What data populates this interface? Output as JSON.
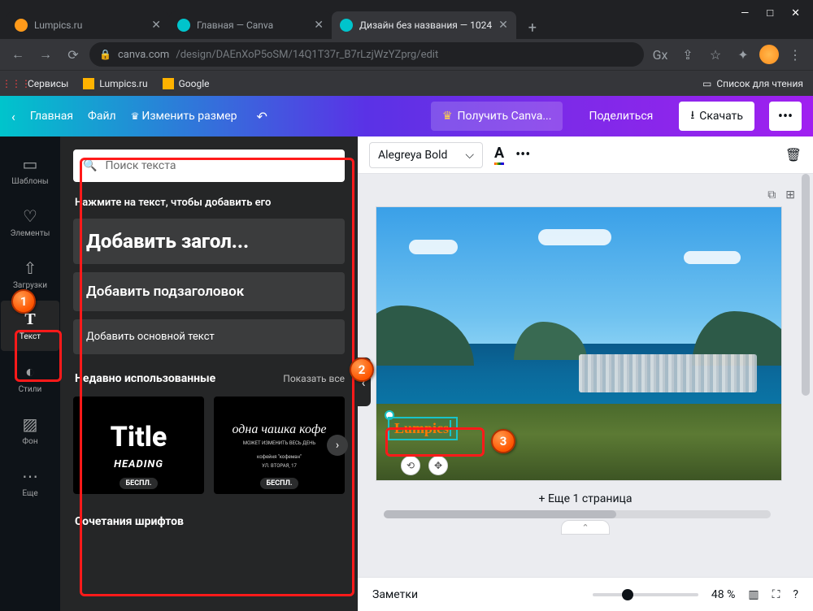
{
  "window": {
    "min": "—",
    "max": "□",
    "close": "✕"
  },
  "tabs": [
    {
      "title": "Lumpics.ru",
      "favicon": "#ff9a1a"
    },
    {
      "title": "Главная — Canva",
      "favicon": "#00c4cc"
    },
    {
      "title": "Дизайн без названия — 1024",
      "favicon": "#00c4cc",
      "active": true
    }
  ],
  "newtab": "+",
  "nav": {
    "back": "←",
    "fwd": "→",
    "reload": "⟳"
  },
  "url": {
    "lock": "🔒",
    "domain": "canva.com",
    "path": "/design/DAEnXoP5oSM/14Q1T37r_B7rLzjWzYZprg/edit"
  },
  "ricons": {
    "gx": "Gx",
    "share": "⇪",
    "star": "☆",
    "puzzle": "✦",
    "menu": "⋮"
  },
  "bookmarks": {
    "apps": "Сервисы",
    "lumpics": "Lumpics.ru",
    "google": "Google",
    "readlist": "Список для чтения"
  },
  "canva": {
    "home": "Главная",
    "file": "Файл",
    "resize": "Изменить размер",
    "getpro": "Получить Canva...",
    "share": "Поделиться",
    "download": "Скачать"
  },
  "sidebar": {
    "items": [
      {
        "icon": "▭",
        "label": "Шаблоны"
      },
      {
        "icon": "♡",
        "label": "Элементы"
      },
      {
        "icon": "⇧",
        "label": "Загрузки"
      },
      {
        "icon": "T",
        "label": "Текст"
      },
      {
        "icon": "◐",
        "label": "Стили"
      },
      {
        "icon": "▨",
        "label": "Фон"
      },
      {
        "icon": "⋯",
        "label": "Еще"
      }
    ]
  },
  "panel": {
    "search_ph": "Поиск текста",
    "hint": "Нажмите на текст, чтобы добавить его",
    "h1": "Добавить загол...",
    "h2": "Добавить подзаголовок",
    "body": "Добавить основной текст",
    "recent": "Недавно использованные",
    "showall": "Показать все",
    "tpl1": {
      "big": "Title",
      "sub": "HEADING",
      "badge": "БЕСПЛ."
    },
    "tpl2": {
      "script": "одна чашка кофе",
      "tiny1": "МОЖЕТ ИЗМЕНИТЬ ВЕСЬ ДЕНЬ",
      "tiny2": "кофейня \"кофеман\"",
      "tiny3": "УЛ. ВТОРАЯ, 17",
      "badge": "БЕСПЛ."
    },
    "fonts_section": "Сочетания шрифтов"
  },
  "toolbar": {
    "font": "Alegreya Bold",
    "dots": "•••"
  },
  "canvas": {
    "text": "Lumpics",
    "addpage": "+ Еще 1 страница"
  },
  "bottom": {
    "notes": "Заметки",
    "zoom": "48 %"
  },
  "markers": {
    "m1": "1",
    "m2": "2",
    "m3": "3"
  }
}
